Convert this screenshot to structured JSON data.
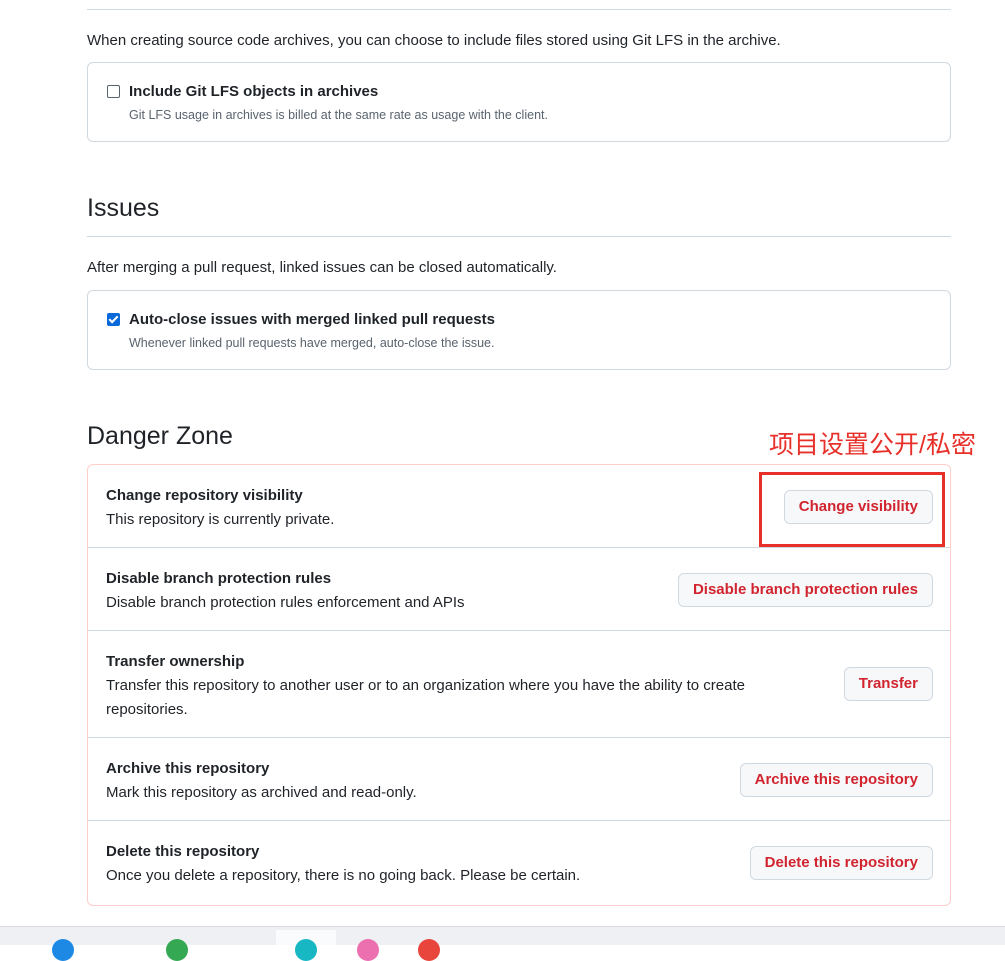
{
  "lfs": {
    "description": "When creating source code archives, you can choose to include files stored using Git LFS in the archive.",
    "checkbox_label": "Include Git LFS objects in archives",
    "checkbox_note": "Git LFS usage in archives is billed at the same rate as usage with the client.",
    "checked": false
  },
  "issues": {
    "heading": "Issues",
    "description": "After merging a pull request, linked issues can be closed automatically.",
    "checkbox_label": "Auto-close issues with merged linked pull requests",
    "checkbox_note": "Whenever linked pull requests have merged, auto-close the issue.",
    "checked": true
  },
  "danger": {
    "heading": "Danger Zone",
    "annotation": "项目设置公开/私密",
    "rows": [
      {
        "title": "Change repository visibility",
        "description": "This repository is currently private.",
        "button": "Change visibility"
      },
      {
        "title": "Disable branch protection rules",
        "description": "Disable branch protection rules enforcement and APIs",
        "button": "Disable branch protection rules"
      },
      {
        "title": "Transfer ownership",
        "description": "Transfer this repository to another user or to an organization where you have the ability to create repositories.",
        "button": "Transfer"
      },
      {
        "title": "Archive this repository",
        "description": "Mark this repository as archived and read-only.",
        "button": "Archive this repository"
      },
      {
        "title": "Delete this repository",
        "description": "Once you delete a repository, there is no going back. Please be certain.",
        "button": "Delete this repository"
      }
    ]
  },
  "colors": {
    "danger_text": "#d1242f",
    "danger_border": "#ffcecb",
    "annotation_red": "#e8302a",
    "checkbox_blue": "#0969da"
  },
  "taskbar": {
    "icons": [
      "edge-icon",
      "chrome-icon",
      "app-icon-teal",
      "app-icon-pink",
      "app-icon-red"
    ]
  }
}
